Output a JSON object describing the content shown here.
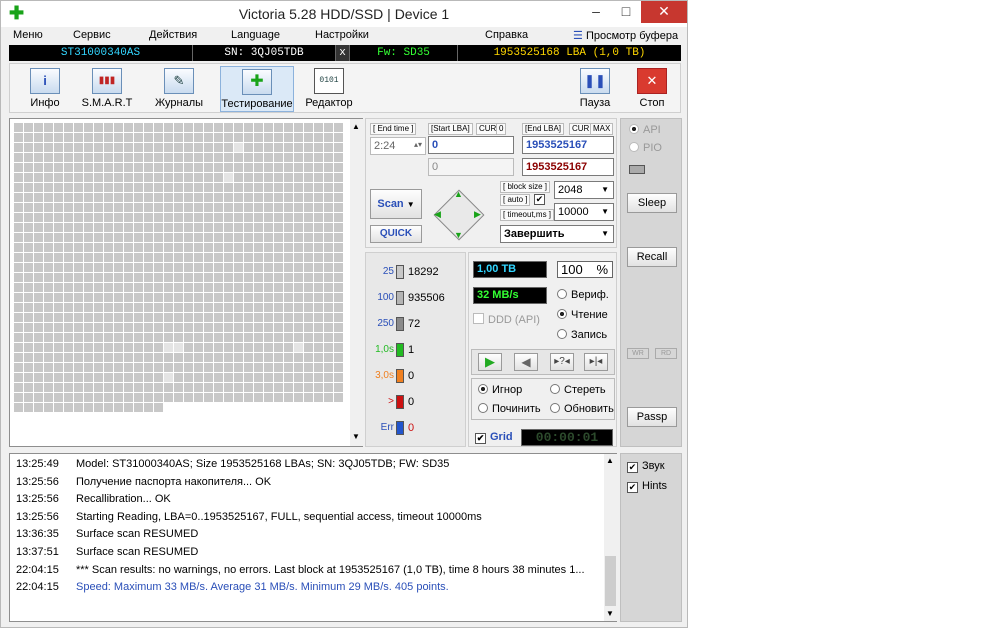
{
  "window": {
    "title": "Victoria 5.28 HDD/SSD | Device 1",
    "minimize": "–",
    "maximize": "□",
    "close": "✕"
  },
  "menu": {
    "items": [
      "Меню",
      "Сервис",
      "Действия",
      "Language",
      "Настройки",
      "Справка"
    ],
    "buffer_view": "Просмотр буфера"
  },
  "device": {
    "model": "ST31000340AS",
    "serial": "SN: 3QJ05TDB",
    "close_x": "x",
    "firmware": "Fw: SD35",
    "lba": "1953525168 LBA (1,0 TB)"
  },
  "toolbar": {
    "tools": [
      {
        "label": "Инфо",
        "icon": "i"
      },
      {
        "label": "S.M.A.R.T",
        "icon": "▮▮▮"
      },
      {
        "label": "Журналы",
        "icon": "✎"
      },
      {
        "label": "Тестирование",
        "icon": "✚"
      },
      {
        "label": "Редактор",
        "icon": "0101"
      }
    ],
    "pause": "Пауза",
    "stop": "Стоп",
    "pause_icon": "❚❚",
    "stop_icon": "✕"
  },
  "scan": {
    "end_time_label": "[ End time ]",
    "end_time": "2:24",
    "start_lba_label": "[Start LBA]",
    "cur": "CUR",
    "zero": "0",
    "start_lba": "0",
    "start_lba_current": "0",
    "end_lba_label": "[End LBA]",
    "max": "MAX",
    "end_lba": "1953525167",
    "end_lba_current": "1953525167",
    "scan_button": "Scan",
    "quick_button": "QUICK",
    "block_size_label": "[ block size ]",
    "auto_label": "[ auto ]",
    "timeout_label": "[ timeout,ms ]",
    "block_size": "2048",
    "timeout": "10000",
    "finish": "Завершить"
  },
  "stats": [
    {
      "label": "25",
      "value": "18292",
      "color": "#c8c8c8"
    },
    {
      "label": "100",
      "value": "935506",
      "color": "#b4b4b4"
    },
    {
      "label": "250",
      "value": "72",
      "color": "#8a8a8a"
    },
    {
      "label": "1,0s",
      "value": "1",
      "color": "#22bb22"
    },
    {
      "label": "3,0s",
      "value": "0",
      "color": "#f08020"
    },
    {
      "label": ">",
      "value": "0",
      "color": "#cc1111"
    },
    {
      "label": "Err",
      "value": "0",
      "color": "#2255cc"
    }
  ],
  "status": {
    "capacity": "1,00 TB",
    "percent": "100",
    "percent_unit": "%",
    "speed": "32 MB/s",
    "ddd": "DDD (API)",
    "verify": "Вериф.",
    "read": "Чтение",
    "write": "Запись",
    "ignore": "Игнор",
    "erase": "Стереть",
    "repair": "Починить",
    "refresh": "Обновить",
    "grid": "Grid",
    "timer": "00:00:01"
  },
  "sidebar": {
    "api": "API",
    "pio": "PIO",
    "sleep": "Sleep",
    "recall": "Recall",
    "wr": "WR",
    "rd": "RD",
    "passp": "Passp"
  },
  "log": [
    {
      "time": "13:25:49",
      "text": "Model: ST31000340AS; Size 1953525168 LBAs; SN: 3QJ05TDB; FW: SD35",
      "blue": false
    },
    {
      "time": "13:25:56",
      "text": "Получение паспорта накопителя... OK",
      "blue": false
    },
    {
      "time": "13:25:56",
      "text": "Recallibration... OK",
      "blue": false
    },
    {
      "time": "13:25:56",
      "text": "Starting Reading, LBA=0..1953525167, FULL, sequential access, timeout 10000ms",
      "blue": false
    },
    {
      "time": "13:36:35",
      "text": "Surface scan RESUMED",
      "blue": false
    },
    {
      "time": "13:37:51",
      "text": "Surface scan RESUMED",
      "blue": false
    },
    {
      "time": "22:04:15",
      "text": "*** Scan results: no warnings, no errors. Last block at 1953525167 (1,0 TB), time 8 hours 38 minutes 1...",
      "blue": false
    },
    {
      "time": "22:04:15",
      "text": "Speed: Maximum 33 MB/s. Average 31 MB/s. Minimum 29 MB/s. 405 points.",
      "blue": true
    }
  ],
  "log_side": {
    "sound": "Звук",
    "hints": "Hints"
  },
  "colors": {
    "accent_blue": "#2a4fb8",
    "lcd_cyan": "#33d6ff",
    "lcd_green": "#33ff33",
    "lcd_white": "#ffffff",
    "play_green": "#22aa22",
    "close_red": "#c7372f",
    "end_lba_red": "#8b0000"
  }
}
